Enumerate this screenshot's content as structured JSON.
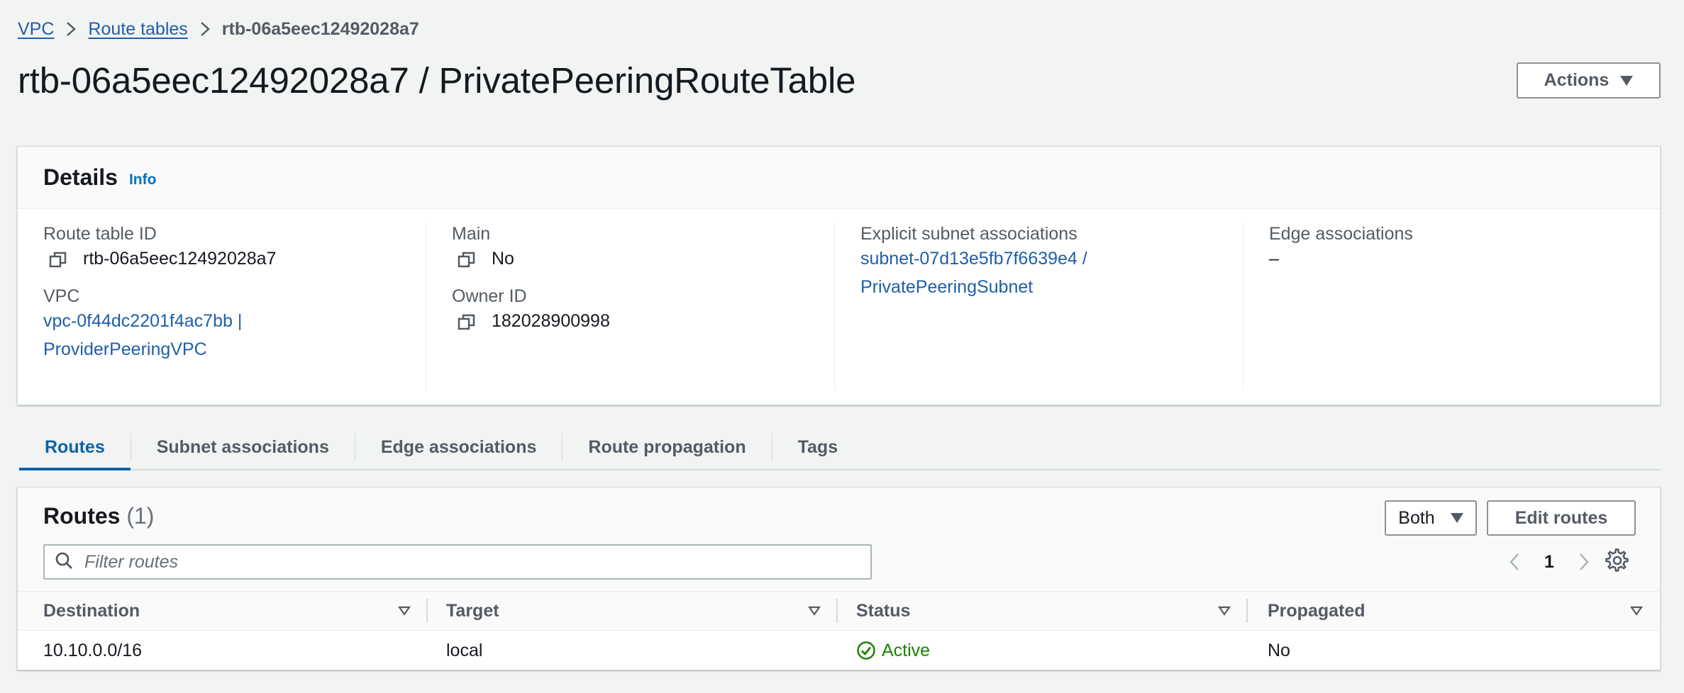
{
  "breadcrumb": {
    "items": [
      {
        "label": "VPC"
      },
      {
        "label": "Route tables"
      }
    ],
    "current": "rtb-06a5eec12492028a7"
  },
  "page": {
    "title": "rtb-06a5eec12492028a7 / PrivatePeeringRouteTable",
    "actions_label": "Actions"
  },
  "details": {
    "title": "Details",
    "info_label": "Info",
    "route_table_id": {
      "label": "Route table ID",
      "value": "rtb-06a5eec12492028a7"
    },
    "vpc": {
      "label": "VPC",
      "line1": "vpc-0f44dc2201f4ac7bb |",
      "line2": "ProviderPeeringVPC"
    },
    "main": {
      "label": "Main",
      "value": "No"
    },
    "owner_id": {
      "label": "Owner ID",
      "value": "182028900998"
    },
    "explicit_subnet_associations": {
      "label": "Explicit subnet associations",
      "line1": "subnet-07d13e5fb7f6639e4 /",
      "line2": "PrivatePeeringSubnet"
    },
    "edge_associations": {
      "label": "Edge associations",
      "value": "–"
    }
  },
  "tabs": [
    {
      "label": "Routes",
      "active": true
    },
    {
      "label": "Subnet associations"
    },
    {
      "label": "Edge associations"
    },
    {
      "label": "Route propagation"
    },
    {
      "label": "Tags"
    }
  ],
  "routes": {
    "title": "Routes",
    "count": "(1)",
    "filter_button": "Both",
    "edit_label": "Edit routes",
    "search_placeholder": "Filter routes",
    "page_number": "1",
    "columns": [
      "Destination",
      "Target",
      "Status",
      "Propagated"
    ],
    "rows": [
      {
        "destination": "10.10.0.0/16",
        "target": "local",
        "status": "Active",
        "propagated": "No"
      }
    ]
  },
  "colors": {
    "link": "#1f5fa7",
    "active_tab": "#0a62a8",
    "status_active": "#1d8102",
    "background": "#f2f3f3"
  }
}
